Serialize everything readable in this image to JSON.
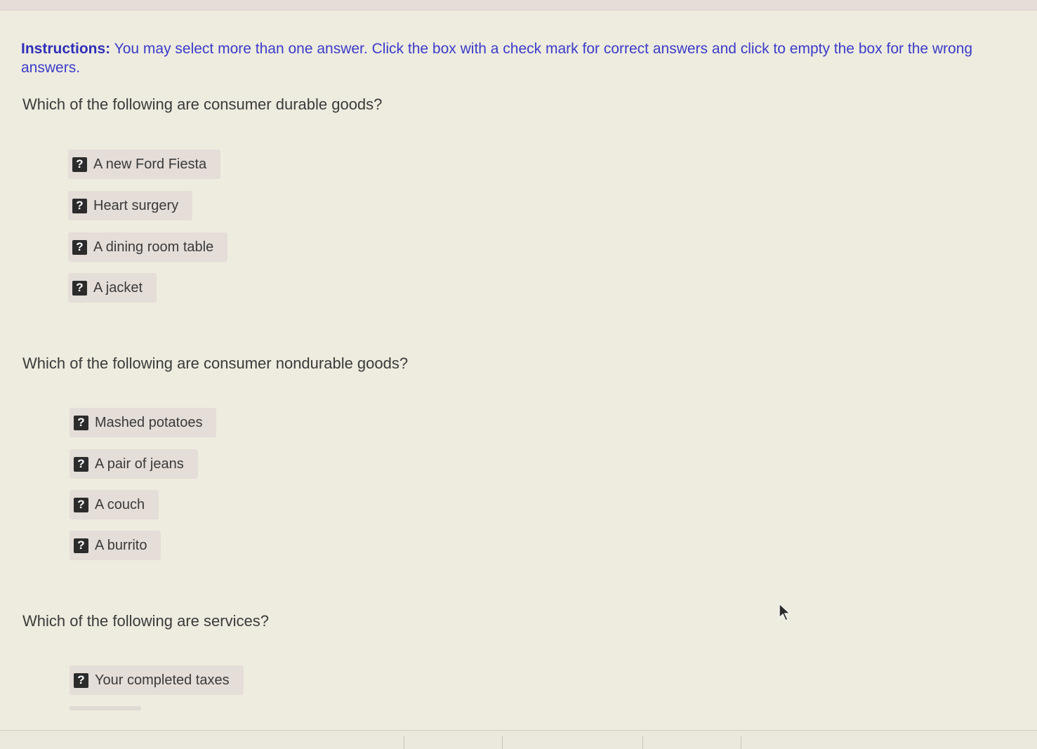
{
  "instructions": {
    "lead": "Instructions:",
    "text": " You may select more than one answer. Click the box with a check mark for correct answers and click to empty the box for the wrong answers."
  },
  "option_marker": "?",
  "questions": [
    {
      "prompt": "Which of the following are consumer durable goods?",
      "options": [
        "A new Ford Fiesta",
        "Heart surgery",
        "A dining room table",
        "A jacket"
      ]
    },
    {
      "prompt": "Which of the following are consumer nondurable goods?",
      "options": [
        "Mashed potatoes",
        "A pair of jeans",
        "A couch",
        "A burrito"
      ]
    },
    {
      "prompt": "Which of the following are services?",
      "options": [
        "Your completed taxes"
      ]
    }
  ],
  "icons": {
    "option_marker": "question-mark-icon",
    "pointer": "mouse-cursor-icon"
  },
  "colors": {
    "background": "#eeecdf",
    "instructions_text": "#3b3bc9",
    "option_bg": "#e4ddd8",
    "marker_bg": "#2b2b2b"
  }
}
